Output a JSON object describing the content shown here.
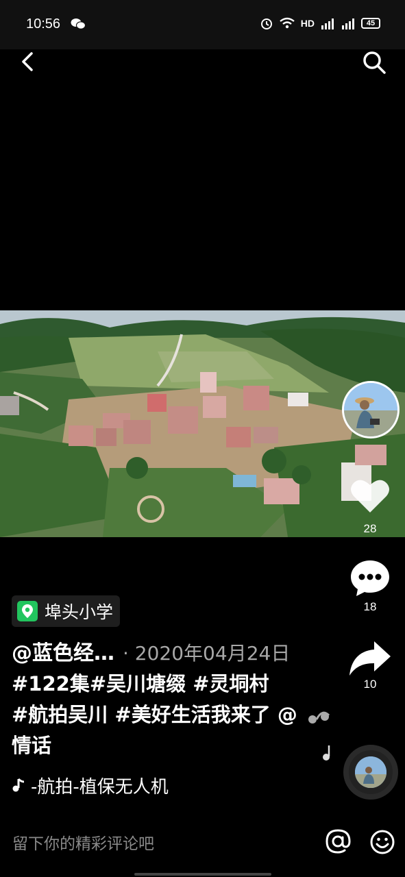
{
  "status_bar": {
    "time": "10:56",
    "network_label": "HD",
    "battery": "45",
    "icons": [
      "wechat-icon",
      "alarm-icon",
      "wifi-icon",
      "signal-4g-icon",
      "signal-4g-icon",
      "battery-icon"
    ]
  },
  "nav": {
    "back_icon": "chevron-left-icon",
    "search_icon": "search-icon"
  },
  "actions": {
    "likes": "28",
    "comments": "18",
    "shares": "10"
  },
  "post": {
    "location": "埠头小学",
    "author": "@蓝色经…",
    "date": "· 2020年04月24日",
    "caption_parts": [
      "#122集#吴川塘缀 ",
      "#灵垌村",
      "#航拍吴川 ",
      "#美好生活我来了 ",
      "@情话"
    ],
    "music": "‑航拍-植保无人机"
  },
  "comment_bar": {
    "placeholder": "留下你的精彩评论吧"
  },
  "colors": {
    "background": "#000000",
    "location_icon": "#22c55e",
    "secondary_text": "#a8a8a8"
  }
}
